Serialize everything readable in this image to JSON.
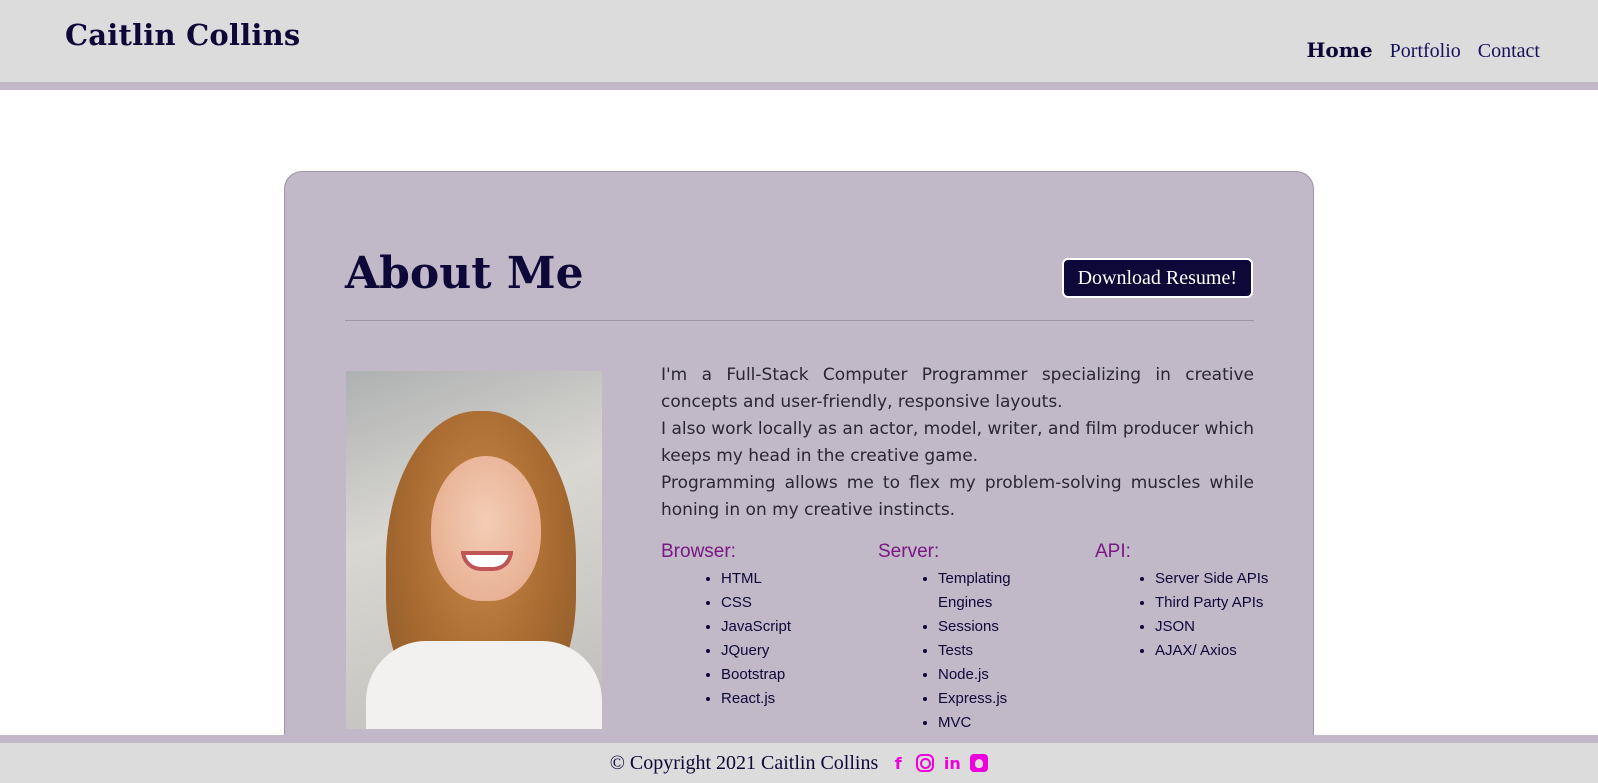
{
  "header": {
    "brand": "Caitlin Collins",
    "nav": [
      {
        "label": "Home",
        "active": true
      },
      {
        "label": "Portfolio",
        "active": false
      },
      {
        "label": "Contact",
        "active": false
      }
    ]
  },
  "about": {
    "title": "About Me",
    "resume_button": "Download Resume!",
    "bio": [
      "I'm a Full-Stack Computer Programmer specializing in creative concepts and user-friendly, responsive layouts.",
      "I also work locally as an actor, model, writer, and film producer which keeps my head in the creative game.",
      "Programming allows me to flex my problem-solving muscles while honing in on my creative instincts."
    ],
    "skills": [
      {
        "heading": "Browser:",
        "items": [
          "HTML",
          "CSS",
          "JavaScript",
          "JQuery",
          "Bootstrap",
          "React.js"
        ]
      },
      {
        "heading": "Server:",
        "items": [
          "Templating Engines",
          "Sessions",
          "Tests",
          "Node.js",
          "Express.js",
          "MVC"
        ]
      },
      {
        "heading": "API:",
        "items": [
          "Server Side APIs",
          "Third Party APIs",
          "JSON",
          "AJAX/ Axios"
        ]
      }
    ]
  },
  "footer": {
    "copyright": "© Copyright 2021 Caitlin Collins",
    "social_icons": [
      "facebook-icon",
      "instagram-icon",
      "linkedin-icon",
      "github-icon"
    ]
  },
  "colors": {
    "navy": "#0d0838",
    "card_bg": "#c1b8c8",
    "header_bg": "#dddcdc",
    "skill_heading": "#7a1785",
    "social_icon": "#ee00dd"
  }
}
